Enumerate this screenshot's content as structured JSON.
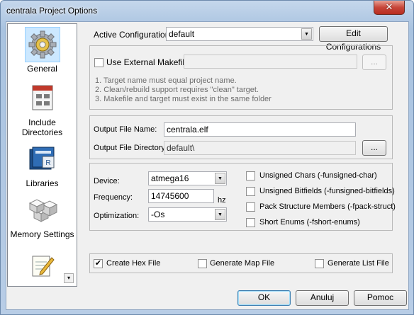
{
  "window": {
    "title": "centrala Project Options",
    "close_glyph": "✕"
  },
  "sidebar": {
    "items": [
      {
        "label": "General",
        "icon": "gear-icon"
      },
      {
        "label": "Include Directories",
        "icon": "include-directories-icon"
      },
      {
        "label": "Libraries",
        "icon": "libraries-icon"
      },
      {
        "label": "Memory Settings",
        "icon": "memory-blocks-icon"
      },
      {
        "label": "",
        "icon": "notepad-pencil-icon"
      }
    ],
    "scroll_glyph": "▾"
  },
  "config": {
    "active_label": "Active Configuration",
    "active_value": "default",
    "edit_button": "Edit Configurations"
  },
  "makefile": {
    "use_external_label": "Use External Makefile",
    "use_external_checked": false,
    "path_value": "",
    "browse_button": "...",
    "notes": [
      "1. Target name must equal project name.",
      "2. Clean/rebuild support requires  \"clean\" target.",
      "3. Makefile and target must exist in the same folder"
    ]
  },
  "output": {
    "file_name_label": "Output File Name:",
    "file_name_value": "centrala.elf",
    "directory_label": "Output File Directory:",
    "directory_value": "default\\",
    "browse_button": "..."
  },
  "device": {
    "device_label": "Device:",
    "device_value": "atmega16",
    "frequency_label": "Frequency:",
    "frequency_value": "14745600",
    "frequency_unit": "hz",
    "optimization_label": "Optimization:",
    "optimization_value": "-Os",
    "options": [
      {
        "label": "Unsigned Chars (-funsigned-char)",
        "checked": false
      },
      {
        "label": "Unsigned Bitfields (-funsigned-bitfields)",
        "checked": false
      },
      {
        "label": "Pack Structure Members (-fpack-struct)",
        "checked": false
      },
      {
        "label": "Short Enums (-fshort-enums)",
        "checked": false
      }
    ]
  },
  "files": {
    "hex_label": "Create Hex File",
    "hex_checked": true,
    "map_label": "Generate Map File",
    "map_checked": false,
    "list_label": "Generate List File",
    "list_checked": false
  },
  "buttons": {
    "ok": "OK",
    "cancel": "Anuluj",
    "help": "Pomoc"
  },
  "check_glyph": "✔"
}
